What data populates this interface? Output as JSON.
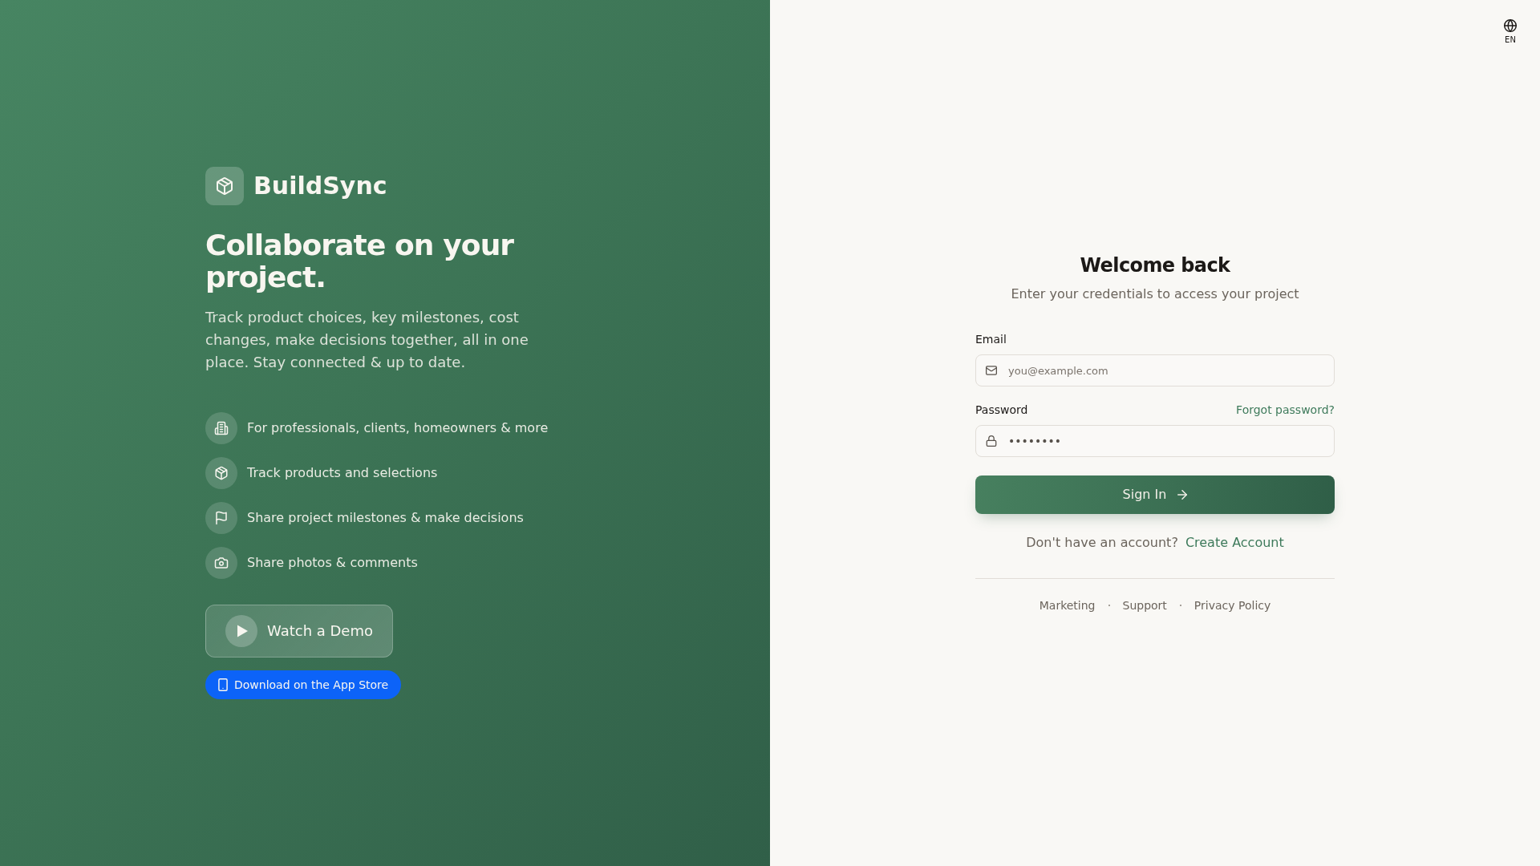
{
  "language_button": {
    "label": "EN"
  },
  "brand": {
    "name": "BuildSync"
  },
  "hero": {
    "headline": "Collaborate on your project.",
    "description": "Track product choices, key milestones, cost changes, make decisions together, all in one place. Stay connected & up to date."
  },
  "features": [
    {
      "text": "For professionals, clients, homeowners & more"
    },
    {
      "text": "Track products and selections"
    },
    {
      "text": "Share project milestones & make decisions"
    },
    {
      "text": "Share photos & comments"
    }
  ],
  "demo_button": {
    "label": "Watch a Demo"
  },
  "app_store_button": {
    "label": "Download on the App Store"
  },
  "login": {
    "title": "Welcome back",
    "subtitle": "Enter your credentials to access your project",
    "email": {
      "label": "Email",
      "placeholder": "you@example.com"
    },
    "password": {
      "label": "Password",
      "placeholder": "••••••••",
      "forgot_link": "Forgot password?"
    },
    "submit": "Sign In",
    "signup_prompt": "Don't have an account?",
    "signup_link": "Create Account"
  },
  "footer_links": [
    "Marketing",
    "Support",
    "Privacy Policy"
  ]
}
